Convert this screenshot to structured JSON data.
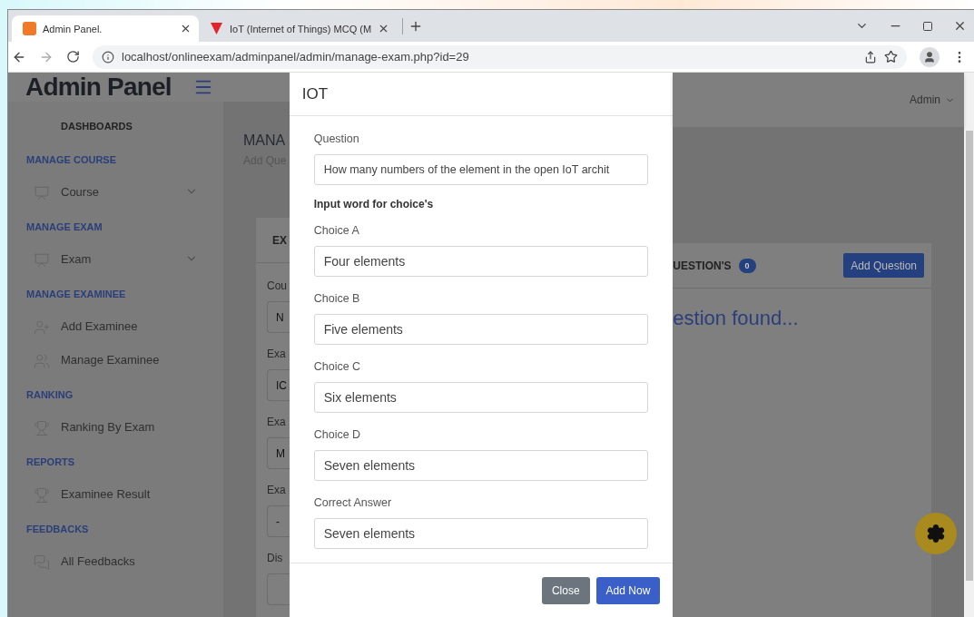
{
  "browser": {
    "tabs": [
      {
        "title": "Admin Panel.",
        "selected": true
      },
      {
        "title": "IoT (Internet of Things) MCQ (M",
        "selected": false
      }
    ],
    "url": "localhost/onlineexam/adminpanel/admin/manage-exam.php?id=29"
  },
  "header": {
    "logo": "Admin Panel",
    "user": "Admin"
  },
  "sidebar": {
    "heading": "DASHBOARDS",
    "sections": [
      {
        "title": "MANAGE COURSE",
        "items": [
          {
            "label": "Course",
            "has_submenu": true
          }
        ]
      },
      {
        "title": "MANAGE EXAM",
        "items": [
          {
            "label": "Exam",
            "has_submenu": true
          }
        ]
      },
      {
        "title": "MANAGE EXAMINEE",
        "items": [
          {
            "label": "Add Examinee",
            "has_submenu": false
          },
          {
            "label": "Manage Examinee",
            "has_submenu": false
          }
        ]
      },
      {
        "title": "RANKING",
        "items": [
          {
            "label": "Ranking By Exam",
            "has_submenu": false
          }
        ]
      },
      {
        "title": "REPORTS",
        "items": [
          {
            "label": "Examinee Result",
            "has_submenu": false
          }
        ]
      },
      {
        "title": "FEEDBACKS",
        "items": [
          {
            "label": "All Feedbacks",
            "has_submenu": false
          }
        ]
      }
    ]
  },
  "page_behind": {
    "title": "MANA",
    "subtitle": "Add Que",
    "card_tab": "EX",
    "form": [
      {
        "label": "Cou",
        "value": "N"
      },
      {
        "label": "Exa",
        "value": "IC"
      },
      {
        "label": "Exa",
        "value": "M"
      },
      {
        "label": "Exa",
        "value": "-"
      },
      {
        "label": "Dis"
      }
    ],
    "questions_tab": "UESTION'S",
    "question_count": "0",
    "add_button": "Add Question",
    "empty_message": "estion found..."
  },
  "modal": {
    "title": "IOT",
    "question": {
      "label": "Question",
      "value": "How many numbers of the element in the open IoT archit"
    },
    "section_label": "Input word for choice's",
    "choices": [
      {
        "label": "Choice A",
        "value": "Four elements"
      },
      {
        "label": "Choice B",
        "value": "Five elements"
      },
      {
        "label": "Choice C",
        "value": "Six elements"
      },
      {
        "label": "Choice D",
        "value": "Seven elements"
      }
    ],
    "correct_answer": {
      "label": "Correct Answer",
      "value": "Seven elements"
    },
    "buttons": [
      {
        "label": "Close",
        "kind": "secondary"
      },
      {
        "label": "Add Now",
        "kind": "primary"
      }
    ]
  }
}
